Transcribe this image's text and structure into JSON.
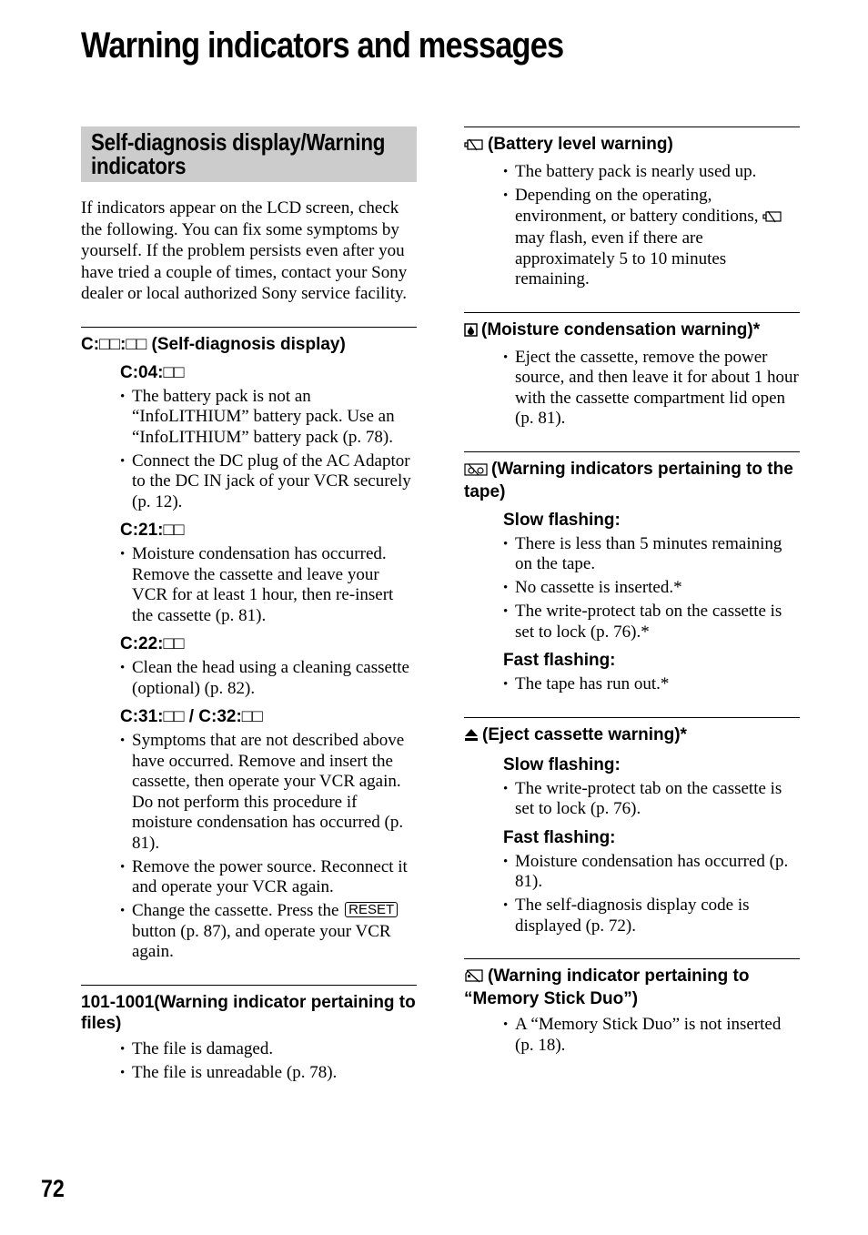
{
  "page": {
    "title": "Warning indicators and messages",
    "page_number": "72"
  },
  "left": {
    "box_heading": "Self-diagnosis display/Warning indicators",
    "intro": "If indicators appear on the LCD screen, check the following. You can fix some symptoms by yourself. If the problem persists even after you have tried a couple of times, contact your Sony dealer or local authorized Sony service facility.",
    "self_diag": {
      "heading": "C:□□:□□ (Self-diagnosis display)",
      "codes": [
        {
          "code": "C:04:□□",
          "bullets": [
            "The battery pack is not an “InfoLITHIUM” battery pack. Use an “InfoLITHIUM” battery pack (p. 78).",
            "Connect the DC plug of the AC Adaptor to the DC IN jack of your VCR securely (p. 12)."
          ]
        },
        {
          "code": "C:21:□□",
          "bullets": [
            "Moisture condensation has occurred. Remove the cassette and leave your VCR for at least 1 hour, then re-insert the cassette (p. 81)."
          ]
        },
        {
          "code": "C:22:□□",
          "bullets": [
            "Clean the head using a cleaning cassette (optional) (p. 82)."
          ]
        },
        {
          "code": "C:31:□□ / C:32:□□",
          "bullets": [
            "Symptoms that are not described above have occurred. Remove and insert the cassette, then operate your VCR again. Do not perform this procedure if moisture condensation has occurred (p. 81).",
            "Remove the power source. Reconnect it and operate your VCR again."
          ],
          "reset_bullet": {
            "before": "Change the cassette. Press the",
            "button": "RESET",
            "after": "button (p. 87), and operate your VCR again."
          }
        }
      ]
    },
    "files": {
      "heading": "101-1001(Warning indicator pertaining to files)",
      "bullets": [
        "The file is damaged.",
        "The file is unreadable (p. 78)."
      ]
    }
  },
  "right": {
    "battery": {
      "icon": "battery-empty-icon",
      "heading": "(Battery level warning)",
      "bullets": [
        "The battery pack is nearly used up."
      ],
      "bullet2_before": "Depending on the operating, environment, or battery conditions,",
      "bullet2_after": "may flash, even if there are approximately 5 to 10 minutes remaining."
    },
    "moisture": {
      "icon": "moisture-drop-icon",
      "heading": "(Moisture condensation warning)*",
      "bullets": [
        "Eject the cassette, remove the power source, and then leave it for about 1 hour with the cassette compartment lid open (p. 81)."
      ]
    },
    "tape": {
      "icon": "tape-warning-icon",
      "heading": "(Warning indicators pertaining to the tape)",
      "slow_label": "Slow flashing:",
      "slow_bullets": [
        "There is less than 5 minutes remaining on the tape.",
        "No cassette is inserted.*",
        "The write-protect tab on the cassette is set to lock (p. 76).*"
      ],
      "fast_label": "Fast flashing:",
      "fast_bullets": [
        "The tape has run out.*"
      ]
    },
    "eject": {
      "icon": "eject-icon",
      "heading": "(Eject cassette warning)*",
      "slow_label": "Slow flashing:",
      "slow_bullets": [
        "The write-protect tab on the cassette is set to lock (p. 76)."
      ],
      "fast_label": "Fast flashing:",
      "fast_bullets": [
        "Moisture condensation has occurred (p. 81).",
        "The self-diagnosis display code is displayed (p. 72)."
      ]
    },
    "memory_stick": {
      "icon": "memory-stick-warning-icon",
      "heading": "(Warning indicator pertaining to “Memory Stick Duo”)",
      "bullets": [
        "A “Memory Stick Duo” is not inserted (p. 18)."
      ]
    }
  }
}
